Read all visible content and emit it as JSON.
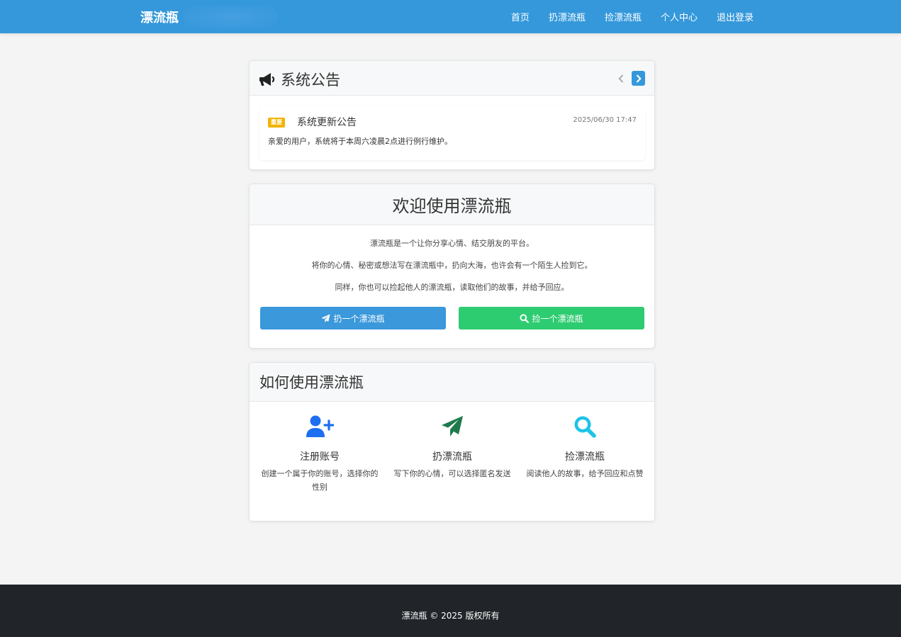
{
  "navbar": {
    "brand": "漂流瓶",
    "links": [
      "首页",
      "扔漂流瓶",
      "捡漂流瓶",
      "个人中心",
      "退出登录"
    ]
  },
  "announcement": {
    "title": "系统公告",
    "icon": "megaphone-icon",
    "item": {
      "badge": "重要",
      "heading": "系统更新公告",
      "date": "2025/06/30 17:47",
      "body": "亲爱的用户，系统将于本周六凌晨2点进行例行维护。"
    }
  },
  "welcome": {
    "title": "欢迎使用漂流瓶",
    "lines": [
      "漂流瓶是一个让你分享心情、结交朋友的平台。",
      "将你的心情、秘密或想法写在漂流瓶中，扔向大海，也许会有一个陌生人捡到它。",
      "同样，你也可以捡起他人的漂流瓶，读取他们的故事，并给予回应。"
    ],
    "throw_button": "扔一个漂流瓶",
    "pick_button": "捡一个漂流瓶"
  },
  "howto": {
    "title": "如何使用漂流瓶",
    "features": [
      {
        "icon": "user-plus-icon",
        "title": "注册账号",
        "desc": "创建一个属于你的账号，选择你的性别"
      },
      {
        "icon": "paper-plane-icon",
        "title": "扔漂流瓶",
        "desc": "写下你的心情，可以选择匿名发送"
      },
      {
        "icon": "search-icon",
        "title": "捡漂流瓶",
        "desc": "阅读他人的故事，给予回应和点赞"
      }
    ]
  },
  "footer": {
    "text": "漂流瓶 © 2025 版权所有"
  },
  "colors": {
    "primary": "#3498db",
    "success": "#2ecc71",
    "warning": "#f1b400",
    "footer": "#212529",
    "icon_blue": "#1e6ff0",
    "icon_green": "#1f7a4c",
    "icon_cyan": "#1ec3e8"
  }
}
